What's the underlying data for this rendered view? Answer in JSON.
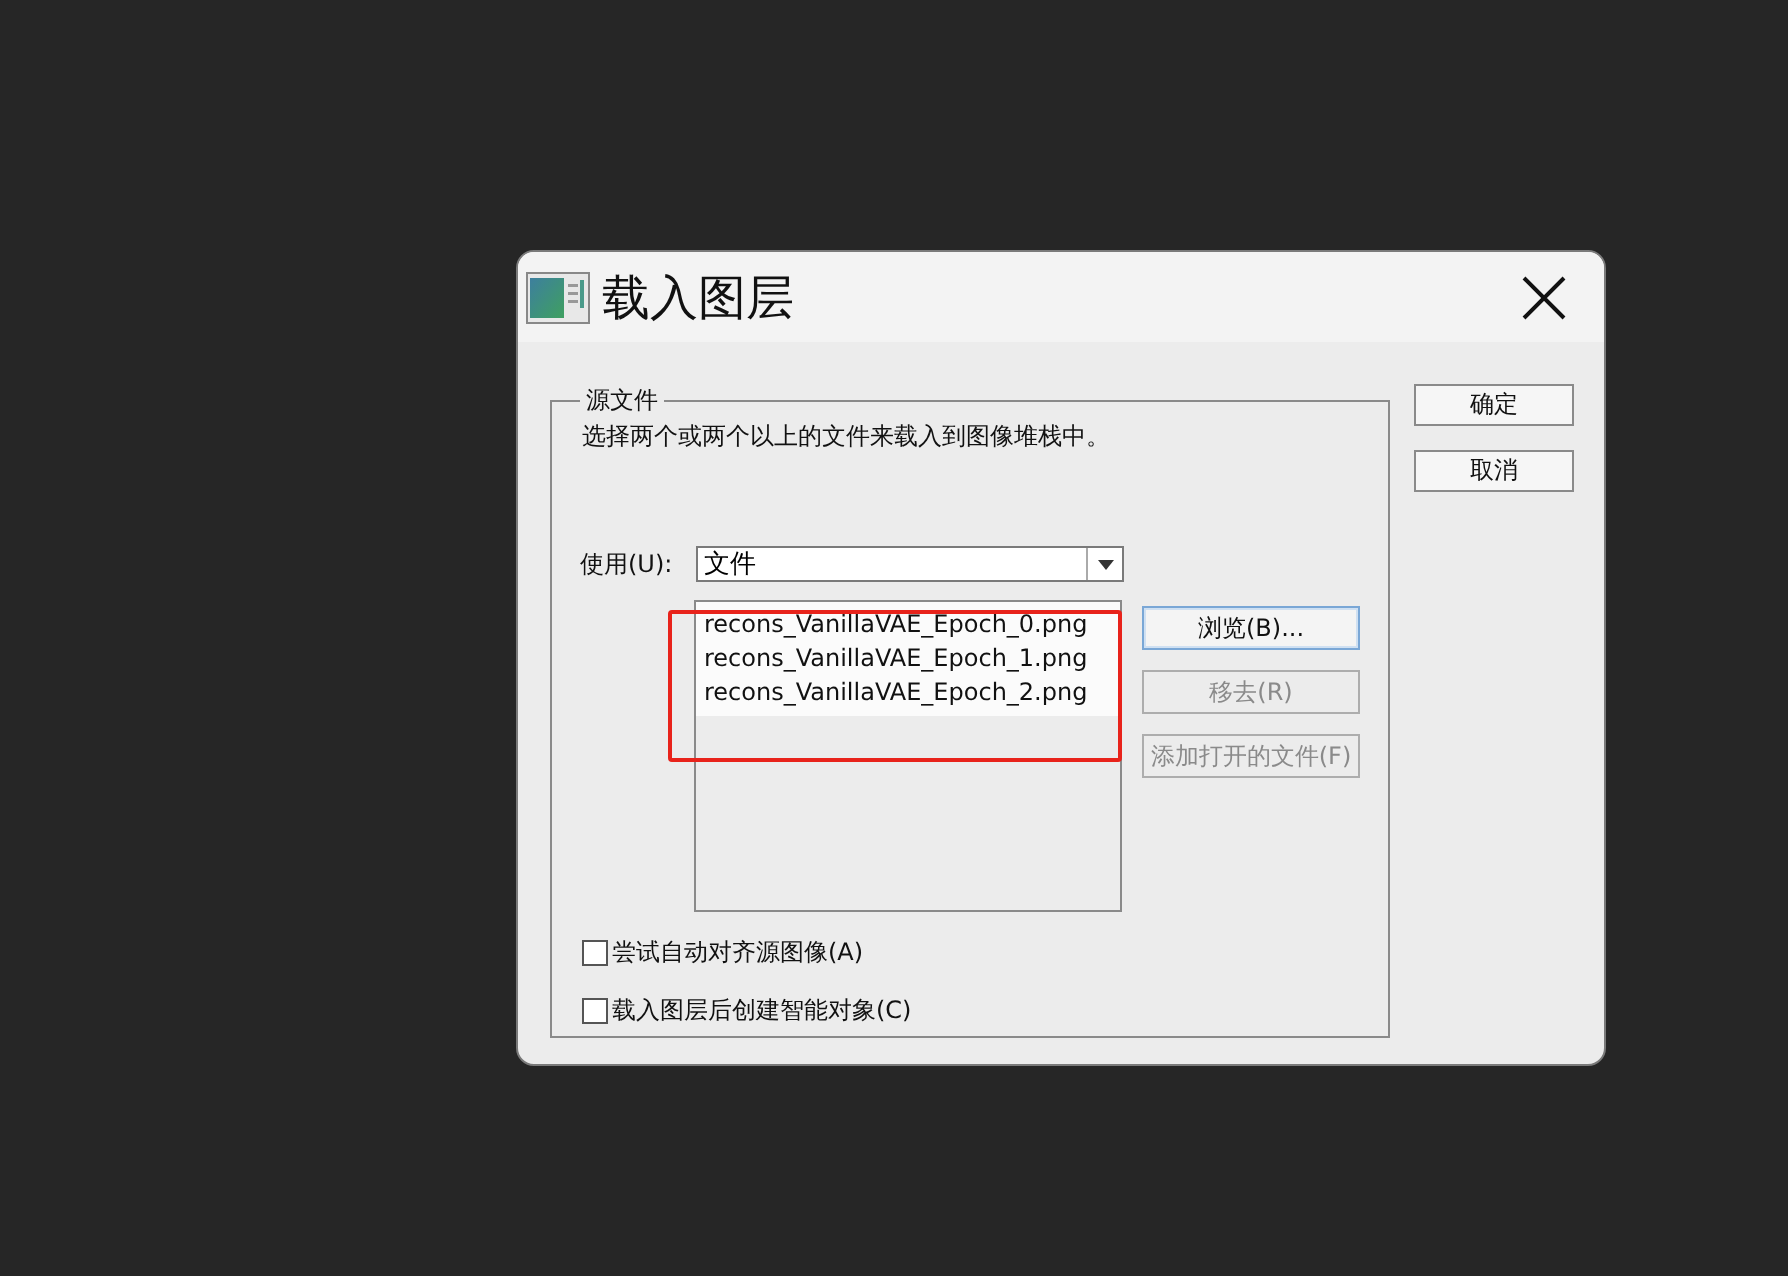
{
  "window": {
    "title": "载入图层"
  },
  "source_group": {
    "legend": "源文件",
    "description": "选择两个或两个以上的文件来载入到图像堆栈中。",
    "use_label": "使用(U):",
    "use_value": "文件",
    "files": [
      "recons_VanillaVAE_Epoch_0.png",
      "recons_VanillaVAE_Epoch_1.png",
      "recons_VanillaVAE_Epoch_2.png"
    ],
    "side_buttons": [
      {
        "label": "浏览(B)...",
        "disabled": false,
        "default": true
      },
      {
        "label": "移去(R)",
        "disabled": true,
        "default": false
      },
      {
        "label": "添加打开的文件(F)",
        "disabled": true,
        "default": false
      }
    ],
    "options": [
      {
        "label": "尝试自动对齐源图像(A)",
        "checked": false
      },
      {
        "label": "载入图层后创建智能对象(C)",
        "checked": false
      }
    ],
    "highlight": true
  },
  "buttons": [
    "确定",
    "取消"
  ]
}
